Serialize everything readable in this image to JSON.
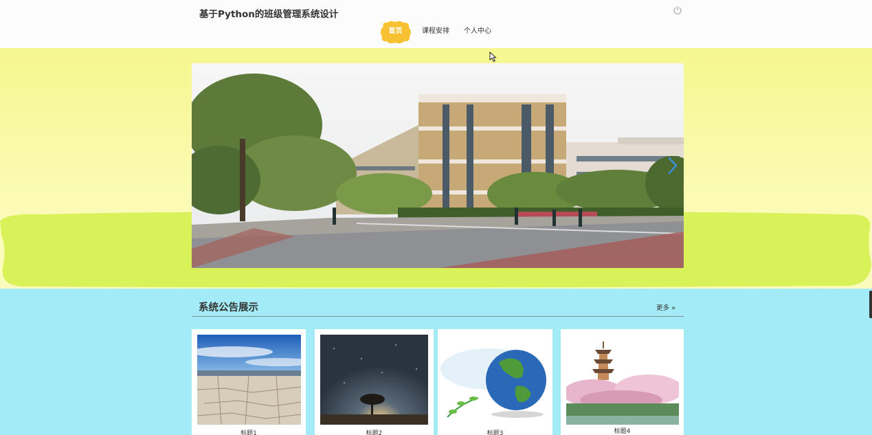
{
  "header": {
    "title": "基于Python的班级管理系统设计",
    "logout_icon": "power-icon"
  },
  "nav": {
    "items": [
      {
        "label": "首页",
        "active": true
      },
      {
        "label": "课程安排",
        "active": false
      },
      {
        "label": "个人中心",
        "active": false
      }
    ],
    "active_color": "#f7c131"
  },
  "banner": {
    "image_description_icon": "campus-photo",
    "next_icon": "chevron-right-icon"
  },
  "notices": {
    "section_title": "系统公告展示",
    "more_label": "更多",
    "more_icon": "double-chevron-right-icon",
    "items": [
      {
        "title": "标题1"
      },
      {
        "title": "标题2"
      },
      {
        "title": "标题3"
      },
      {
        "title": "标题4"
      }
    ]
  },
  "colors": {
    "header_bg": "#fdfcfd",
    "hero_yellow": "#f7f891",
    "hero_green": "#d9f25a",
    "section_bg": "#a3ecf7",
    "accent": "#3a8fd8"
  }
}
